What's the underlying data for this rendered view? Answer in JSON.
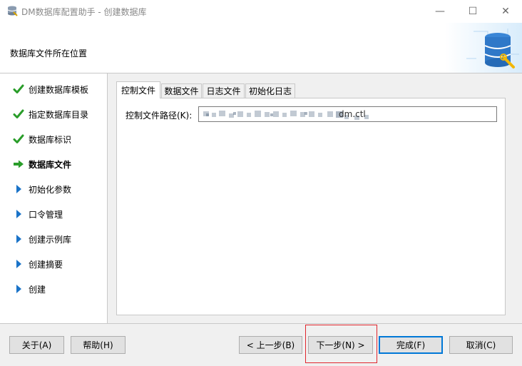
{
  "window": {
    "title": "DM数据库配置助手 - 创建数据库",
    "minimize_glyph": "—",
    "maximize_glyph": "☐",
    "close_glyph": "✕"
  },
  "header": {
    "title": "数据库文件所在位置"
  },
  "steps": [
    {
      "label": "创建数据库模板",
      "state": "done",
      "icon": "check-icon"
    },
    {
      "label": "指定数据库目录",
      "state": "done",
      "icon": "check-icon"
    },
    {
      "label": "数据库标识",
      "state": "done",
      "icon": "check-icon"
    },
    {
      "label": "数据库文件",
      "state": "current",
      "icon": "arrow-right-icon"
    },
    {
      "label": "初始化参数",
      "state": "pending",
      "icon": "triangle-right-icon"
    },
    {
      "label": "口令管理",
      "state": "pending",
      "icon": "triangle-right-icon"
    },
    {
      "label": "创建示例库",
      "state": "pending",
      "icon": "triangle-right-icon"
    },
    {
      "label": "创建摘要",
      "state": "pending",
      "icon": "triangle-right-icon"
    },
    {
      "label": "创建",
      "state": "pending",
      "icon": "triangle-right-icon"
    }
  ],
  "tabs": [
    {
      "label": "控制文件",
      "active": true
    },
    {
      "label": "数据文件",
      "active": false
    },
    {
      "label": "日志文件",
      "active": false
    },
    {
      "label": "初始化日志",
      "active": false
    }
  ],
  "control_file": {
    "label": "控制文件路径(K):",
    "value_visible_suffix": "dm.ctl"
  },
  "buttons": {
    "about": "关于(A)",
    "help": "帮助(H)",
    "back": "< 上一步(B)",
    "next": "下一步(N) >",
    "finish": "完成(F)",
    "cancel": "取消(C)"
  },
  "colors": {
    "check": "#2a9d2a",
    "arrow": "#2a9d2a",
    "pending_triangle": "#1a73c8",
    "highlight": "#e0262d",
    "accent": "#0078d7"
  }
}
